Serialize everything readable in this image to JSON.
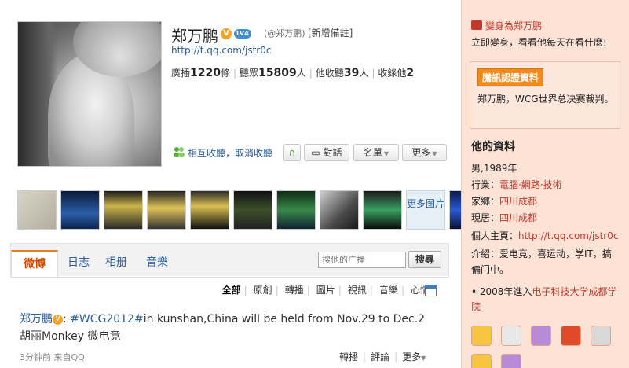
{
  "profile": {
    "name": "郑万鹏",
    "verified": "V",
    "level": "LV4",
    "handle": "(@郑万鹏)",
    "add_remark": "[新增備註]",
    "url": "http://t.qq.com/jstr0c",
    "stats": {
      "broadcast_label": "廣播",
      "broadcast": "1220",
      "broadcast_unit": "條",
      "listeners_label": "聽眾",
      "listeners": "15809",
      "listeners_unit": "人",
      "he_listens_label": "他收聽",
      "he_listens": "39",
      "he_listens_unit": "人",
      "listens_him_label": "收錄他",
      "listens_him": "2"
    }
  },
  "actions": {
    "mutual": "相互收聽，取消收聽",
    "chat": "對話",
    "list": "名單",
    "more": "更多"
  },
  "photos": {
    "more": "更多图片"
  },
  "tabs": [
    "微博",
    "日志",
    "相册",
    "音樂"
  ],
  "search": {
    "placeholder": "搜他的广播",
    "button": "搜尋"
  },
  "filters": [
    "全部",
    "原創",
    "轉播",
    "圖片",
    "視訊",
    "音樂",
    "心情"
  ],
  "post": {
    "author": "郑万鹏",
    "verified": "V",
    "hashtag": "#WCG2012#",
    "text": "in kunshan,China will be held from Nov.29 to Dec.2 胡丽Monkey 微电竞",
    "time": "3分钟前 来自QQ",
    "repost": "轉播",
    "comment": "評論",
    "more": "更多"
  },
  "sidebar": {
    "transform_title": "變身為郑万鹏",
    "transform_desc": "立即變身，看看他每天在看什麼!",
    "cert_label": "騰訊認證資料",
    "cert_text": "郑万鹏，WCG世界总决赛裁判。",
    "info_title": "他的資料",
    "gender_birth": "男,1989年",
    "industry_label": "行業：",
    "industry": "電腦·網路·技術",
    "hometown_label": "家鄉：",
    "hometown": "四川成都",
    "residence_label": "現居：",
    "residence": "四川成都",
    "homepage_label": "個人主頁：",
    "homepage": "http://t.qq.com/jstr0c",
    "intro_label": "介紹：",
    "intro": "爱电竞，喜运动，学IT，搞偏门中。",
    "edu_prefix": "• 2008年進入",
    "edu_school": "电子科技大学成都学院"
  },
  "colors": {
    "accent": "#e67e22",
    "link": "#2b5e9a",
    "sidebar_bg": "#fde2d6",
    "sidebar_link": "#c0392b"
  }
}
